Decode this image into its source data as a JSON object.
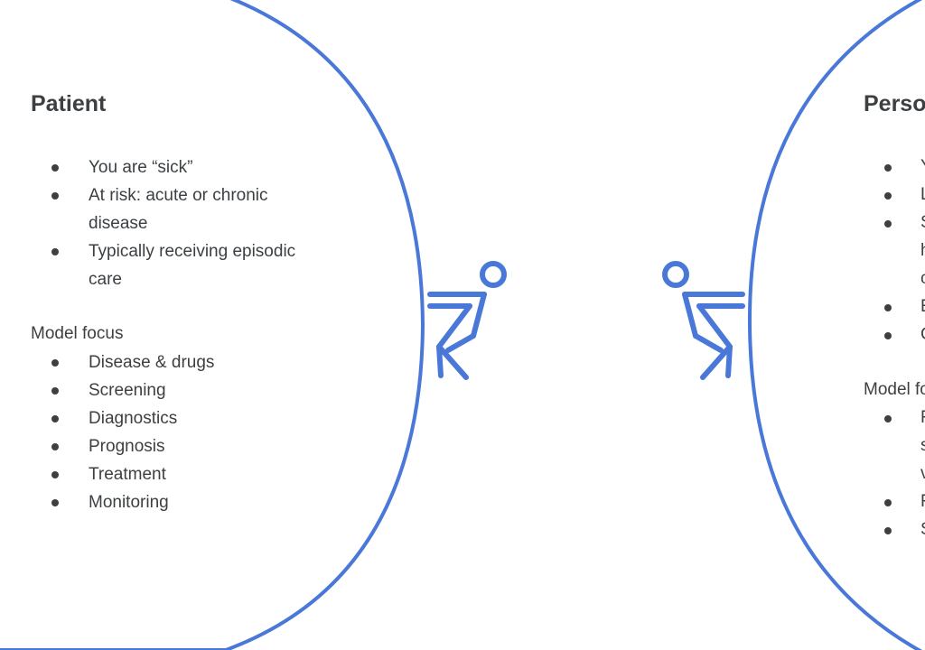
{
  "left_panel": {
    "title": "Patient",
    "bullets": [
      "You are “sick”",
      "At risk: acute or chronic disease",
      "Typically receiving episodic care"
    ],
    "model_focus_label": "Model focus",
    "model_focus_items": [
      "Disease & drugs",
      "Screening",
      "Diagnostics",
      "Prognosis",
      "Treatment",
      "Monitoring"
    ]
  },
  "right_panel": {
    "title_visible": "Perso",
    "model_focus_label_visible": "Model fo",
    "bullet_fragments": [
      "Y",
      "L",
      "S",
      "h",
      "c",
      "E",
      "C",
      "F",
      "s",
      "v",
      "F",
      "S"
    ]
  },
  "colors": {
    "outline_blue": "#4a78d8",
    "text": "#3c4043"
  },
  "icons": [
    "person-pulling-left-icon",
    "person-pulling-right-icon"
  ]
}
